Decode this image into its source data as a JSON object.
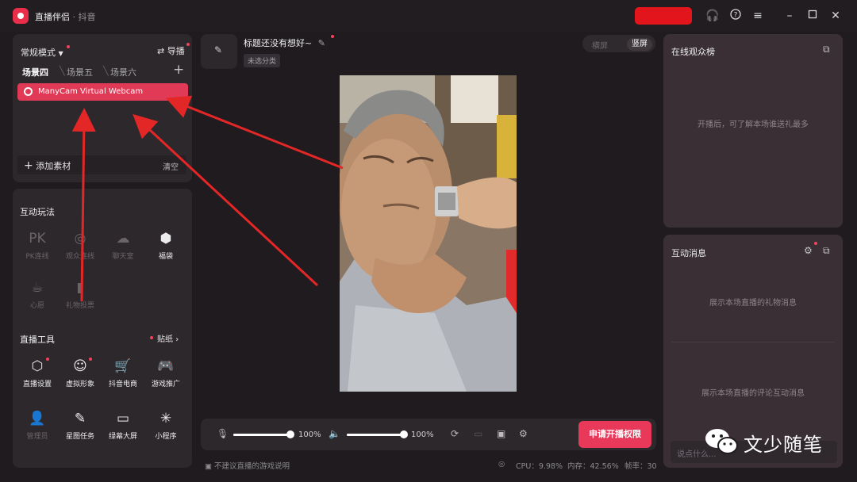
{
  "app": {
    "name": "直播伴侣",
    "sub": "· 抖音"
  },
  "window_controls": {
    "icons": [
      "headset-icon",
      "help-icon",
      "menu-icon",
      "minimize-icon",
      "maximize-icon",
      "close-icon"
    ]
  },
  "left_panel": {
    "mode": "常规模式",
    "guide": "导播",
    "scenes": [
      "场景四",
      "场景五",
      "场景六"
    ],
    "source": "ManyCam Virtual Webcam",
    "add_material": "添加素材",
    "clear": "清空"
  },
  "interact": {
    "title": "互动玩法",
    "items": [
      {
        "icon": "PK",
        "label": "PK连线",
        "dim": true
      },
      {
        "icon": "◎",
        "label": "观众连线",
        "dim": true
      },
      {
        "icon": "☁",
        "label": "聊天室",
        "dim": true
      },
      {
        "icon": "⬢",
        "label": "福袋",
        "dim": false
      },
      {
        "icon": "☕",
        "label": "心愿",
        "dim": true
      },
      {
        "icon": "▮",
        "label": "礼物投票",
        "dim": true
      }
    ]
  },
  "tools": {
    "title": "直播工具",
    "sticker": "贴纸",
    "items": [
      {
        "icon": "⬡",
        "label": "直播设置",
        "dim": false
      },
      {
        "icon": "☺",
        "label": "虚拟形象",
        "dim": false
      },
      {
        "icon": "🛒",
        "label": "抖音电商",
        "dim": false
      },
      {
        "icon": "🎮",
        "label": "游戏推广",
        "dim": false
      },
      {
        "icon": "👤",
        "label": "管理员",
        "dim": true
      },
      {
        "icon": "✎",
        "label": "星图任务",
        "dim": false
      },
      {
        "icon": "▭",
        "label": "绿幕大屏",
        "dim": false
      },
      {
        "icon": "✳",
        "label": "小程序",
        "dim": false
      }
    ]
  },
  "stream": {
    "title_placeholder": "标题还没有想好~",
    "category": "未选分类",
    "orient_h": "横屏",
    "orient_v": "竖屏"
  },
  "right_panel": {
    "audience_title": "在线观众榜",
    "audience_hint": "开播后，可了解本场谁送礼最多",
    "messages_title": "互动消息",
    "gift_hint": "展示本场直播的礼物消息",
    "comment_hint": "展示本场直播的评论互动消息",
    "input_placeholder": "说点什么..."
  },
  "bottom": {
    "mic_volume": "100%",
    "speaker_volume": "100%",
    "mic_level": 1.0,
    "speaker_level": 1.0,
    "apply_btn": "申请开播权限"
  },
  "status": {
    "notice": "不建议直播的游戏说明",
    "cpu": "CPU：9.98%",
    "mem": "内存：42.56%",
    "fps": "帧率：30"
  },
  "watermark": {
    "text": "文少随笔"
  },
  "colors": {
    "accent": "#e9395a",
    "panel": "#2d282c",
    "background": "#1f1b1f"
  }
}
